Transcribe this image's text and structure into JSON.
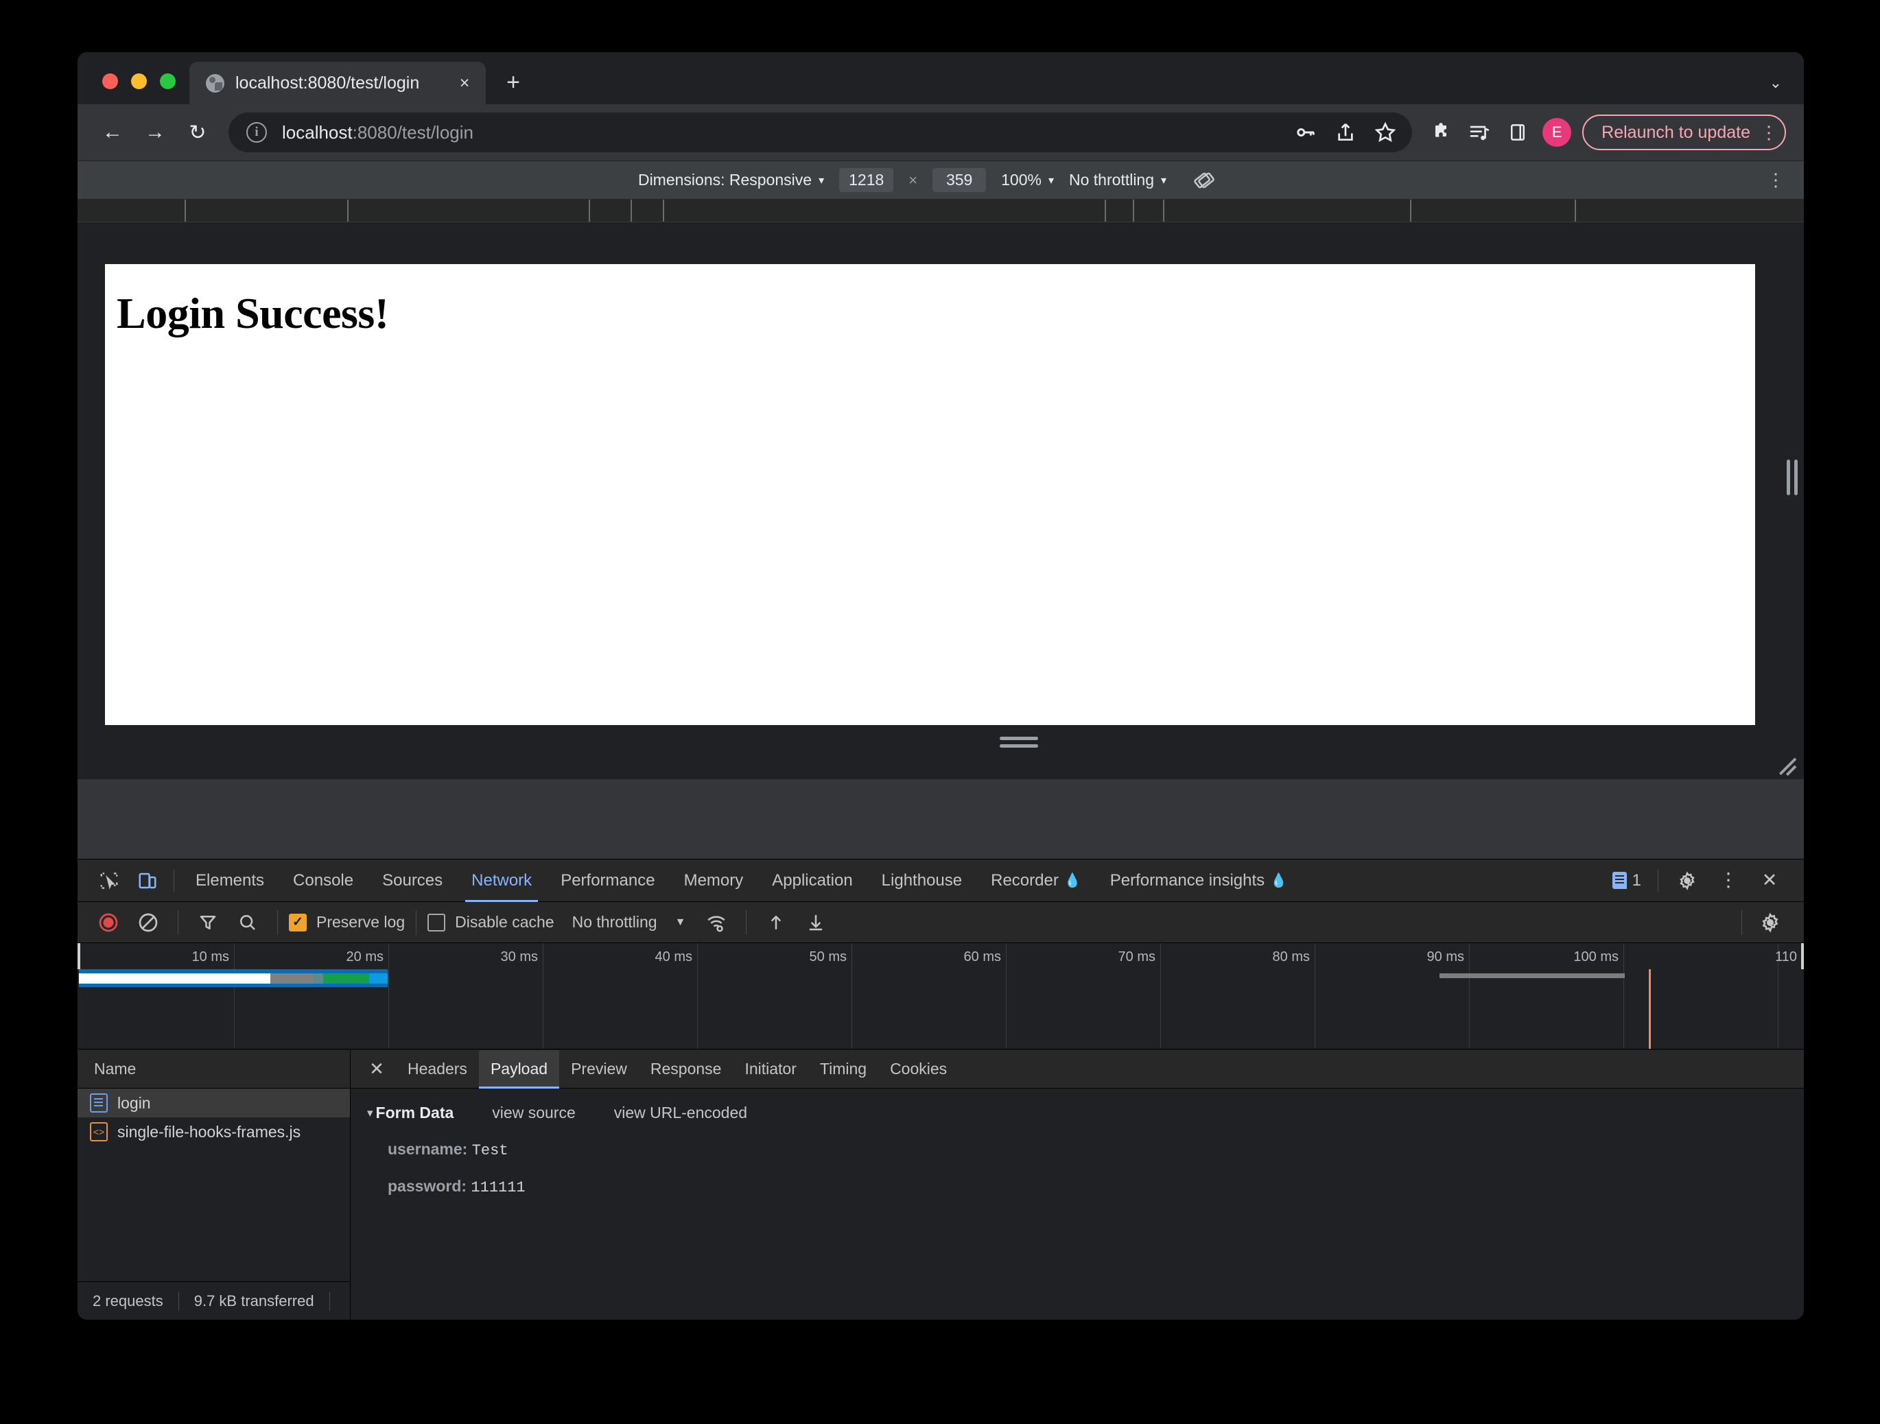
{
  "browser": {
    "tab": {
      "title": "localhost:8080/test/login",
      "favicon": "globe-icon",
      "close": "×"
    },
    "new_tab": "+",
    "tabstrip_caret": "⌄",
    "nav": {
      "back": "←",
      "forward": "→",
      "reload": "↻"
    },
    "omnibox": {
      "host": "localhost",
      "rest": ":8080/test/login",
      "info_icon_glyph": "i",
      "actions": [
        "key-icon",
        "share-icon",
        "star-icon"
      ]
    },
    "toolbar_icons": [
      "extensions-puzzle-icon",
      "media-playlist-icon",
      "side-panel-icon"
    ],
    "avatar_letter": "E",
    "relaunch": {
      "label": "Relaunch to update",
      "menu": "⋮",
      "color": "#f6a6b6"
    }
  },
  "device_toolbar": {
    "dimensions_label": "Dimensions: Responsive",
    "width": "1218",
    "x": "×",
    "height": "359",
    "zoom": "100%",
    "throttling": "No throttling",
    "rotate_icon": "rotate-icon",
    "kebab": "⋮"
  },
  "page": {
    "heading": "Login Success!"
  },
  "devtools": {
    "tabs": [
      {
        "label": "Elements",
        "selected": false,
        "experimental": false
      },
      {
        "label": "Console",
        "selected": false,
        "experimental": false
      },
      {
        "label": "Sources",
        "selected": false,
        "experimental": false
      },
      {
        "label": "Network",
        "selected": true,
        "experimental": false
      },
      {
        "label": "Performance",
        "selected": false,
        "experimental": false
      },
      {
        "label": "Memory",
        "selected": false,
        "experimental": false
      },
      {
        "label": "Application",
        "selected": false,
        "experimental": false
      },
      {
        "label": "Lighthouse",
        "selected": false,
        "experimental": false
      },
      {
        "label": "Recorder",
        "selected": false,
        "experimental": true
      },
      {
        "label": "Performance insights",
        "selected": false,
        "experimental": true
      }
    ],
    "issues_count": "1",
    "settings_icon": "gear-icon",
    "more_icon": "⋮",
    "close_icon": "✕",
    "network_toolbar": {
      "record_icon": "record-stop-icon",
      "clear_icon": "clear-icon",
      "filter_icon": "filter-funnel-icon",
      "search_icon": "search-icon",
      "preserve_log": {
        "label": "Preserve log",
        "checked": true,
        "check_glyph": "✓"
      },
      "disable_cache": {
        "label": "Disable cache",
        "checked": false
      },
      "throttling": "No throttling",
      "caret": "▼",
      "wifi_icon": "network-conditions-icon",
      "import_icon": "import-har-icon",
      "export_icon": "export-har-icon",
      "settings_icon": "gear-icon"
    },
    "overview": {
      "ticks": [
        "10 ms",
        "20 ms",
        "30 ms",
        "40 ms",
        "50 ms",
        "60 ms",
        "70 ms",
        "80 ms",
        "90 ms",
        "100 ms",
        "110"
      ],
      "waterfall_segments": [
        {
          "name": "queueing",
          "color": "#ffffff",
          "width_pct": 62
        },
        {
          "name": "stalled",
          "color": "#808080",
          "width_pct": 14
        },
        {
          "name": "waiting-ttfb",
          "color": "#5e8a8f",
          "width_pct": 3
        },
        {
          "name": "content-download",
          "color": "#14a04a",
          "width_pct": 15
        },
        {
          "name": "receiving",
          "color": "#0e9ae0",
          "width_pct": 6
        }
      ],
      "bar_outline_color": "#0b6cb5",
      "dom_content_loaded_color": "#7d7d7d",
      "load_event_color": "#ef8e5a"
    },
    "requests": {
      "column_header": "Name",
      "rows": [
        {
          "name": "login",
          "icon": "document-icon",
          "selected": true
        },
        {
          "name": "single-file-hooks-frames.js",
          "icon": "script-icon",
          "selected": false
        }
      ],
      "status": {
        "requests": "2 requests",
        "transferred": "9.7 kB transferred"
      }
    },
    "detail": {
      "close_icon": "✕",
      "tabs": [
        {
          "label": "Headers",
          "selected": false
        },
        {
          "label": "Payload",
          "selected": true
        },
        {
          "label": "Preview",
          "selected": false
        },
        {
          "label": "Response",
          "selected": false
        },
        {
          "label": "Initiator",
          "selected": false
        },
        {
          "label": "Timing",
          "selected": false
        },
        {
          "label": "Cookies",
          "selected": false
        }
      ],
      "payload": {
        "section_caret": "▾",
        "section_title": "Form Data",
        "view_source": "view source",
        "view_url_encoded": "view URL-encoded",
        "fields": [
          {
            "key": "username:",
            "value": "Test"
          },
          {
            "key": "password:",
            "value": "111111"
          }
        ]
      }
    }
  }
}
